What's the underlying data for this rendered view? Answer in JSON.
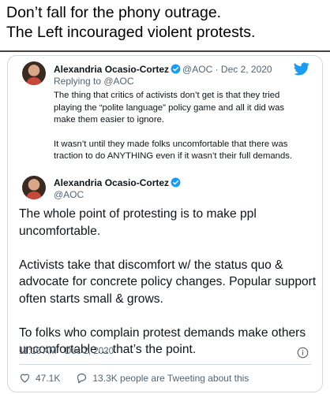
{
  "caption": {
    "line1": "Don’t fall for the phony outrage.",
    "line2": "The Left incouraged violent protests."
  },
  "quoted_tweet": {
    "author_name": "Alexandria Ocasio-Cortez",
    "handle_date": "@AOC · Dec 2, 2020",
    "replying_to": "Replying to @AOC",
    "paragraph1": "The thing that critics of activists don’t get is that they tried playing the “polite language” policy game and all it did was make them easier to ignore.",
    "paragraph2": "It wasn’t until they made folks uncomfortable that there was traction to do ANYTHING even if it wasn’t their full demands."
  },
  "main_tweet": {
    "author_name": "Alexandria Ocasio-Cortez",
    "handle": "@AOC",
    "paragraph1": "The whole point of protesting is to make ppl uncomfortable.",
    "paragraph2": "Activists take that discomfort w/ the status quo & advocate for concrete policy changes. Popular support often starts small & grows.",
    "paragraph3": "To folks who complain protest demands make others uncomfortable… that’s the point.",
    "timestamp": "11:16 AM · Dec 2, 2020",
    "likes": "47.1K",
    "tweeting": "13.3K people are Tweeting about this"
  },
  "icons": {
    "verified": "verified-badge-icon",
    "logo": "twitter-bird-icon",
    "info": "info-icon",
    "like": "heart-icon",
    "reply": "speech-bubble-icon"
  },
  "colors": {
    "brand": "#1d9bf0",
    "text": "#0f1419",
    "muted": "#536471",
    "border": "#cfd9de"
  }
}
